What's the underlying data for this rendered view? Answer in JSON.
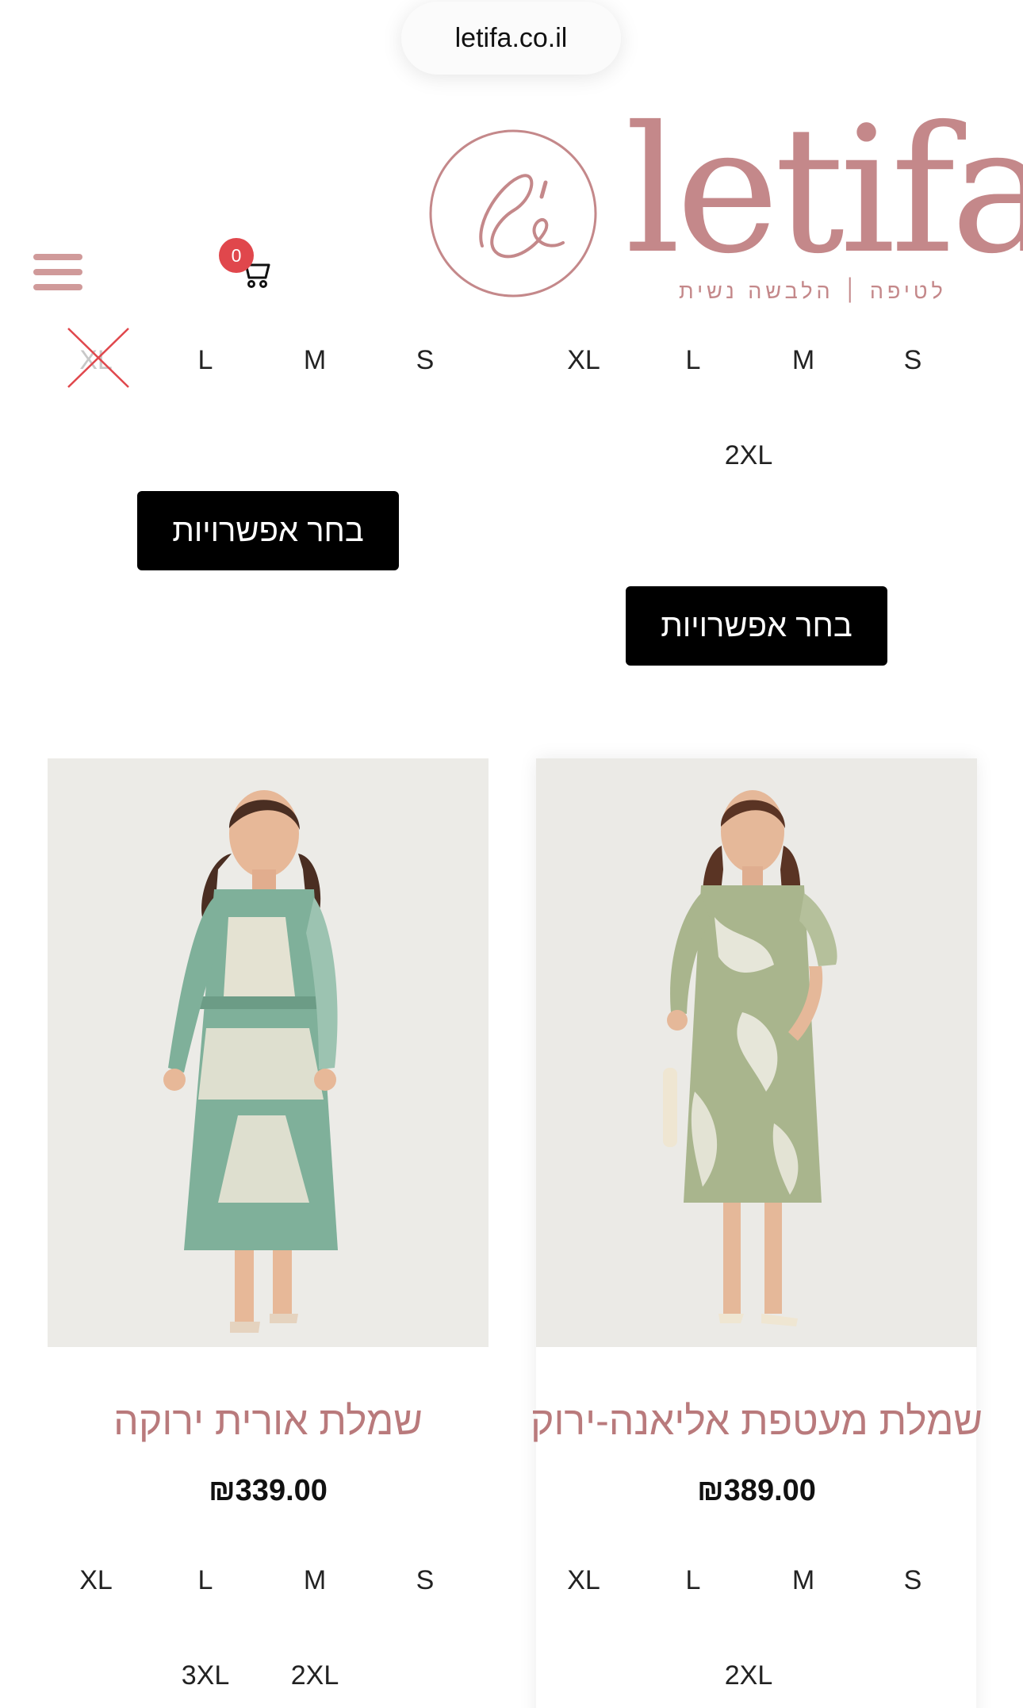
{
  "browser": {
    "url": "letifa.co.il"
  },
  "brand": {
    "name": "letifa",
    "tagline": "לטיפה ׀ הלבשה נשית",
    "color": "#c4888a"
  },
  "header": {
    "menu_icon": "hamburger-menu-icon",
    "cart_icon": "shopping-cart-icon",
    "cart_count": "0"
  },
  "top_row": {
    "left": {
      "sizes": [
        "XL",
        "L",
        "M",
        "S"
      ],
      "unavailable": [
        "XL"
      ],
      "button": "בחר אפשרויות"
    },
    "right": {
      "sizes": [
        "XL",
        "L",
        "M",
        "S",
        "2XL"
      ],
      "button": "בחר אפשרויות"
    }
  },
  "products": [
    {
      "title": "שמלת אורית ירוקה",
      "price": "₪339.00",
      "sizes": [
        "XL",
        "L",
        "M",
        "S",
        "3XL",
        "2XL"
      ],
      "image": "woman-in-green-ikat-shirt-dress"
    },
    {
      "title": "שמלת מעטפת אליאנה-ירוק",
      "price": "₪389.00",
      "sizes": [
        "XL",
        "L",
        "M",
        "S",
        "2XL"
      ],
      "image": "woman-in-sage-floral-wrap-dress"
    }
  ]
}
